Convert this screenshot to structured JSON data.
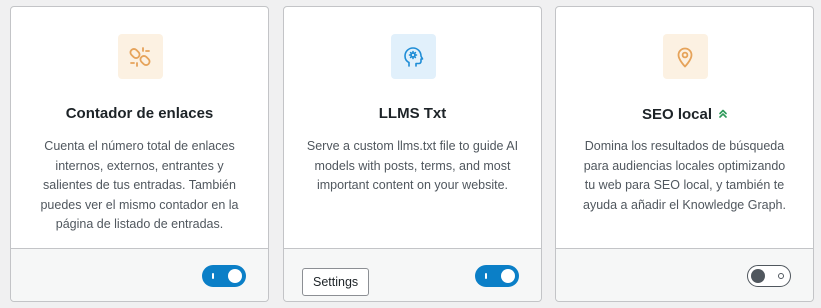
{
  "cards": [
    {
      "title": "Contador de enlaces",
      "icon": "broken-link-icon",
      "icon_bg": "#fcf1e2",
      "icon_color": "#e6a35a",
      "description": "Cuenta el número total de enlaces internos, externos, entrantes y salientes de tus entradas. También puedes ver el mismo contador en la página de listado de entradas.",
      "toggle": "on"
    },
    {
      "title": "LLMS Txt",
      "icon": "ai-head-icon",
      "icon_bg": "#e1f0fb",
      "icon_color": "#1f8dd6",
      "description": "Serve a custom llms.txt file to guide AI models with posts, terms, and most important content on your website.",
      "settings_label": "Settings",
      "toggle": "on"
    },
    {
      "title": "SEO local",
      "icon": "location-pin-icon",
      "icon_bg": "#fcf1e2",
      "icon_color": "#e6a35a",
      "badge_icon": "double-chevron-up-icon",
      "badge_color": "#2e9a5a",
      "description": "Domina los resultados de búsqueda para audiencias locales optimizando tu web para SEO local, y también te ayuda a añadir el Knowledge Graph.",
      "toggle": "off"
    }
  ],
  "colors": {
    "toggle_on": "#0b7fc7",
    "toggle_off": "#50575e",
    "border": "#c3c4c7"
  }
}
